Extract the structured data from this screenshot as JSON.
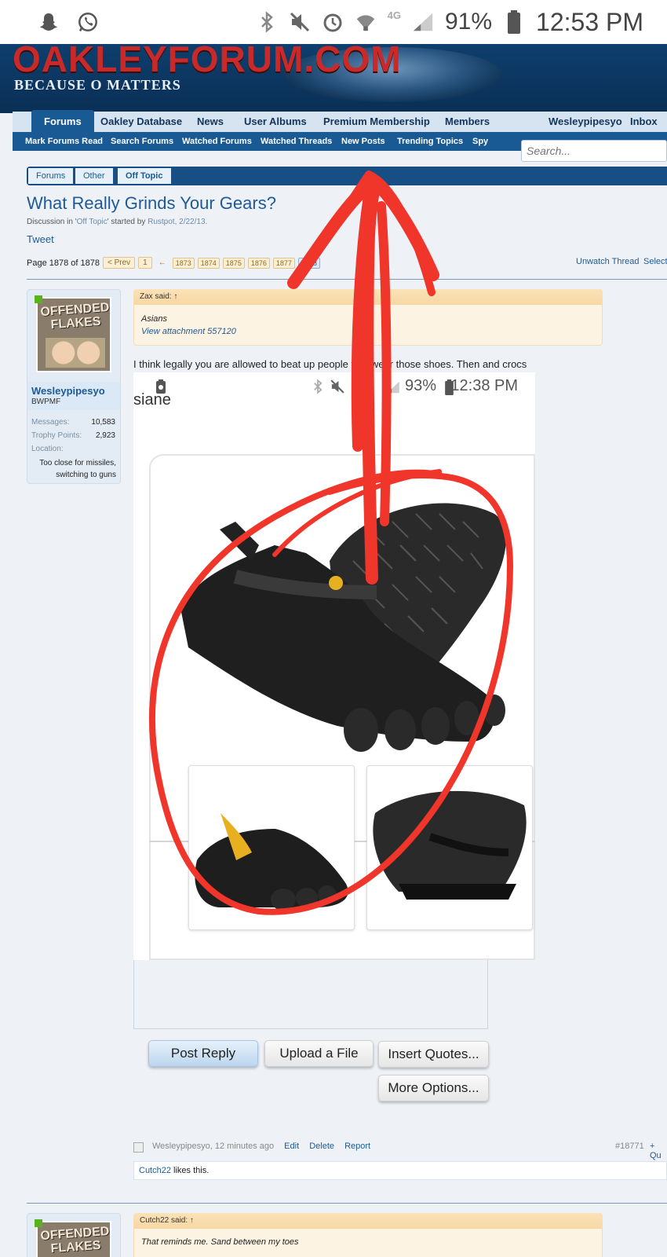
{
  "status_bar": {
    "battery_pct": "91%",
    "time": "12:53 PM",
    "network": "4G",
    "icons": [
      "snapchat-icon",
      "whatsapp-icon",
      "bluetooth-icon",
      "mute-icon",
      "alarm-icon",
      "wifi-icon",
      "signal-icon",
      "battery-icon"
    ]
  },
  "site": {
    "logo": "OAKLEYFORUM.COM",
    "tagline": "BECAUSE O MATTERS"
  },
  "nav": {
    "tabs": [
      "Forums",
      "Oakley Database",
      "News",
      "User Albums",
      "Premium Membership",
      "Members"
    ],
    "user": "Wesleypipesyo",
    "inbox": "Inbox",
    "sub": [
      "Mark Forums Read",
      "Search Forums",
      "Watched Forums",
      "Watched Threads",
      "New Posts",
      "Trending Topics",
      "Spy"
    ],
    "search_placeholder": "Search..."
  },
  "breadcrumb": [
    "Forums",
    "Other",
    "Off Topic"
  ],
  "thread": {
    "title": "What Really Grinds Your Gears?",
    "meta_prefix": "Discussion in '",
    "meta_forum": "Off Topic",
    "meta_mid": "' started by ",
    "meta_author": "Rustpot",
    "meta_date": ", 2/22/13.",
    "tweet": "Tweet",
    "page_label": "Page 1878 of 1878",
    "prev": "< Prev",
    "pages": [
      "1",
      "1873",
      "1874",
      "1875",
      "1876",
      "1877",
      "1878"
    ],
    "ellipsis": "←",
    "unwatch": "Unwatch Thread",
    "select": "Select"
  },
  "post": {
    "username": "Wesleypipesyo",
    "user_title": "BWPMF",
    "stats": [
      {
        "label": "Messages:",
        "value": "10,583"
      },
      {
        "label": "Trophy Points:",
        "value": "2,923"
      },
      {
        "label": "Location:",
        "value": ""
      }
    ],
    "location": "Too close for missiles, switching to guns",
    "quote_author": "Zax said: ↑",
    "quote_line": "Asians",
    "quote_attachment": "View attachment 557120",
    "message": "I think legally you are allowed to beat up people that wear those shoes. Then and crocs",
    "attachment": {
      "battery_pct": "93%",
      "time": "12:38 PM",
      "partial_text": "siane"
    },
    "buttons": {
      "post_reply": "Post Reply",
      "upload": "Upload a File",
      "insert_quotes": "Insert Quotes...",
      "more_options": "More Options..."
    },
    "footer_author": "Wesleypipesyo, 12 minutes ago",
    "edit": "Edit",
    "delete": "Delete",
    "report": "Report",
    "number": "#18771",
    "quote_link": "+ Qu",
    "likes_user": "Cutch22",
    "likes_text": " likes this."
  },
  "next_post": {
    "quote_author": "Cutch22 said: ↑",
    "quote_line": "That reminds me. Sand between my toes"
  },
  "colors": {
    "accent": "#1a5a94",
    "annotation": "#f0352b"
  }
}
